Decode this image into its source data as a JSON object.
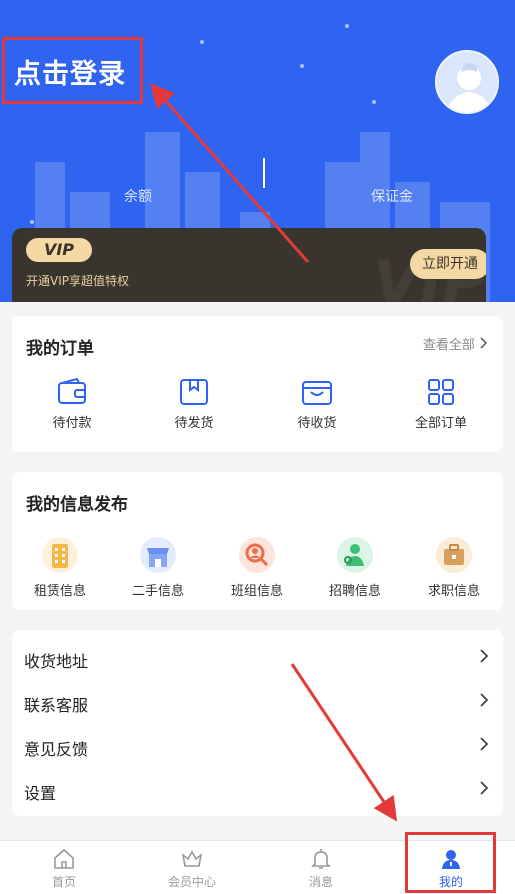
{
  "header": {
    "login_text": "点击登录",
    "balance_label": "余额",
    "deposit_label": "保证金"
  },
  "vip": {
    "badge": "VIP",
    "desc": "开通VIP享超值特权",
    "button": "立即开通",
    "watermark": "VIP"
  },
  "orders": {
    "title": "我的订单",
    "view_all": "查看全部",
    "items": [
      {
        "label": "待付款",
        "icon": "wallet-icon"
      },
      {
        "label": "待发货",
        "icon": "box-icon"
      },
      {
        "label": "待收货",
        "icon": "package-open-icon"
      },
      {
        "label": "全部订单",
        "icon": "grid-icon"
      }
    ]
  },
  "info": {
    "title": "我的信息发布",
    "items": [
      {
        "label": "租赁信息",
        "icon": "building-icon"
      },
      {
        "label": "二手信息",
        "icon": "store-icon"
      },
      {
        "label": "班组信息",
        "icon": "team-search-icon"
      },
      {
        "label": "招聘信息",
        "icon": "recruit-icon"
      },
      {
        "label": "求职信息",
        "icon": "briefcase-icon"
      }
    ]
  },
  "menu": {
    "items": [
      {
        "label": "收货地址"
      },
      {
        "label": "联系客服"
      },
      {
        "label": "意见反馈"
      },
      {
        "label": "设置"
      }
    ]
  },
  "tabbar": {
    "tabs": [
      {
        "label": "首页",
        "icon": "home-icon"
      },
      {
        "label": "会员中心",
        "icon": "crown-icon"
      },
      {
        "label": "消息",
        "icon": "bell-icon"
      },
      {
        "label": "我的",
        "icon": "user-icon"
      }
    ],
    "active_index": 3
  },
  "colors": {
    "primary": "#2f64f0",
    "highlight": "#e23a3a",
    "vip_gold": "#f4d9a5",
    "vip_dark": "#39352e"
  }
}
